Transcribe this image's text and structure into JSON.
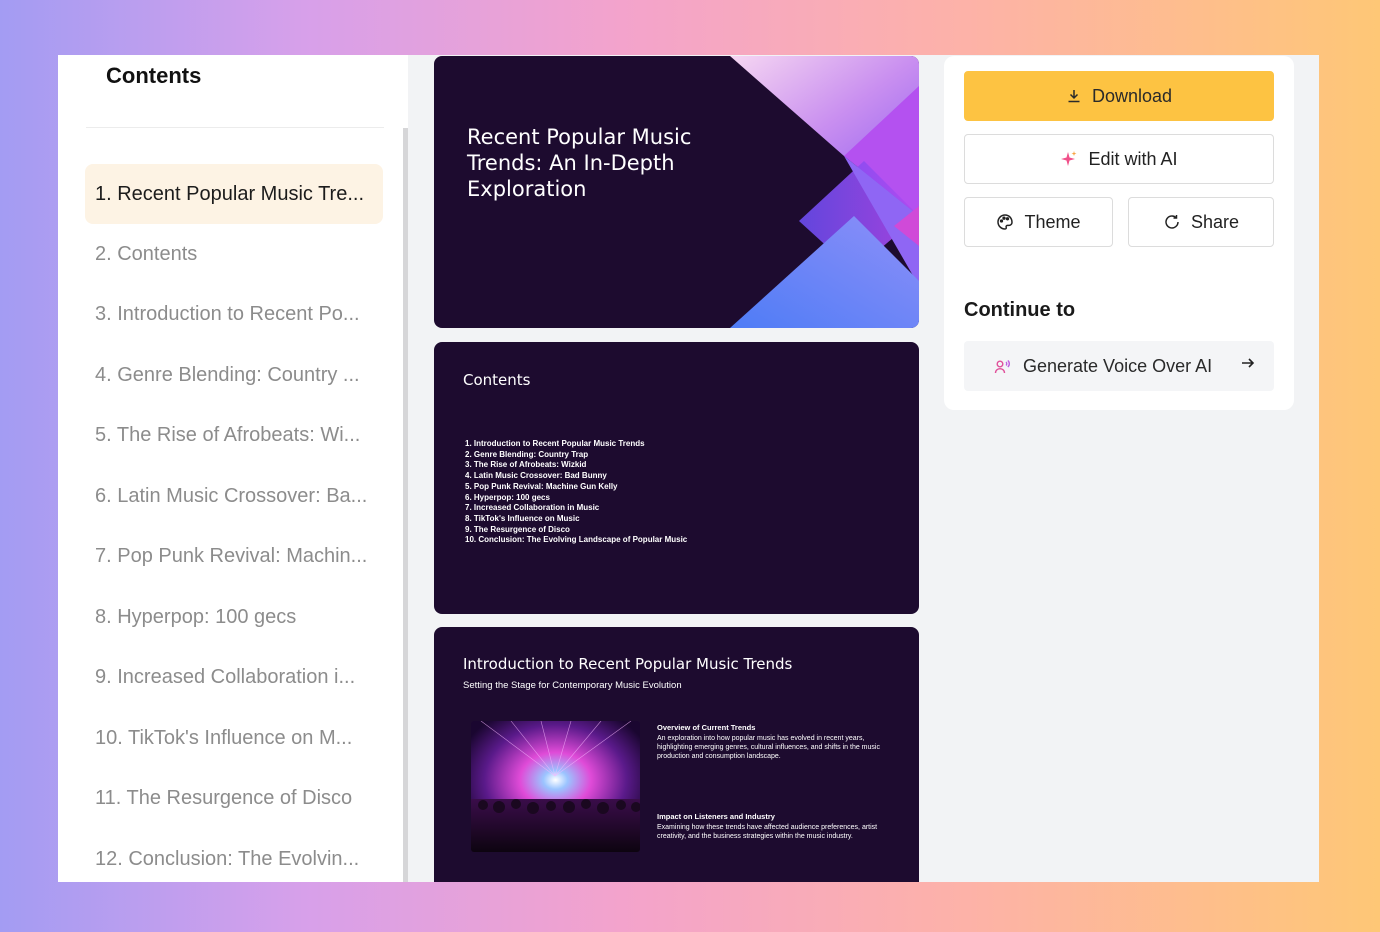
{
  "sidebar": {
    "title": "Contents",
    "items": [
      {
        "label": "1. Recent Popular Music Tre..."
      },
      {
        "label": "2. Contents"
      },
      {
        "label": "3. Introduction to Recent Po..."
      },
      {
        "label": "4. Genre Blending: Country ..."
      },
      {
        "label": "5. The Rise of Afrobeats: Wi..."
      },
      {
        "label": "6. Latin Music Crossover: Ba..."
      },
      {
        "label": "7. Pop Punk Revival: Machin..."
      },
      {
        "label": "8. Hyperpop: 100 gecs"
      },
      {
        "label": "9. Increased Collaboration i..."
      },
      {
        "label": "10. TikTok's Influence on M..."
      },
      {
        "label": "11. The Resurgence of Disco"
      },
      {
        "label": "12. Conclusion: The Evolvin..."
      }
    ]
  },
  "slides": {
    "title_slide": {
      "title": "Recent Popular Music Trends: An In-Depth Exploration"
    },
    "contents_slide": {
      "title": "Contents",
      "items": [
        "1. Introduction to Recent Popular Music Trends",
        "2. Genre Blending: Country Trap",
        "3. The Rise of Afrobeats: Wizkid",
        "4. Latin Music Crossover: Bad Bunny",
        "5. Pop Punk Revival: Machine Gun Kelly",
        "6. Hyperpop: 100 gecs",
        "7. Increased Collaboration in Music",
        "8. TikTok's Influence on Music",
        "9. The Resurgence of Disco",
        "10. Conclusion: The Evolving Landscape of Popular Music"
      ]
    },
    "intro_slide": {
      "title": "Introduction to Recent Popular Music Trends",
      "subtitle": "Setting the Stage for Contemporary Music Evolution",
      "block1_heading": "Overview of Current Trends",
      "block1_body": "An exploration into how popular music has evolved in recent years, highlighting emerging genres, cultural influences, and shifts in the music production and consumption landscape.",
      "block2_heading": "Impact on Listeners and Industry",
      "block2_body": "Examining how these trends have affected audience preferences, artist creativity, and the business strategies within the music industry."
    }
  },
  "panel": {
    "download_label": "Download",
    "edit_label": "Edit with AI",
    "theme_label": "Theme",
    "share_label": "Share",
    "continue_title": "Continue to",
    "continue_item_label": "Generate Voice Over AI"
  },
  "colors": {
    "accent": "#fdc342",
    "slide_bg": "#1d0b2f",
    "active_item_bg": "#fdf3e4"
  }
}
